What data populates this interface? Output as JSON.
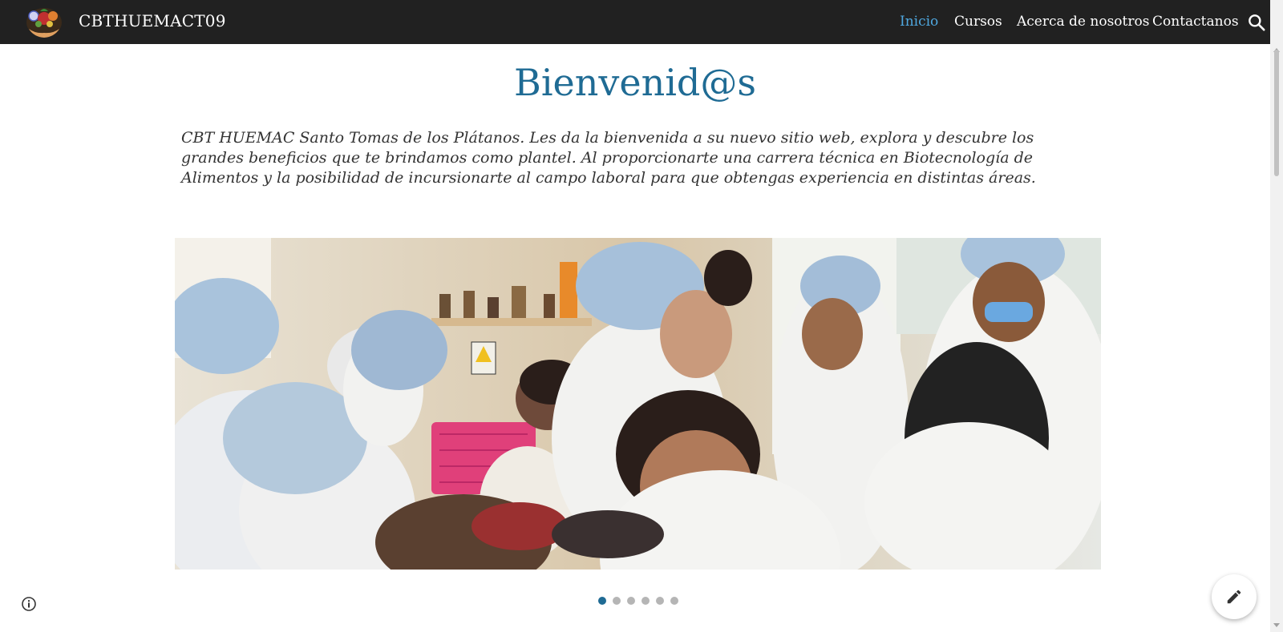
{
  "header": {
    "site_title": "CBTHUEMACT09",
    "logo_icon": "school-logo-icon",
    "nav": [
      {
        "label": "Inicio",
        "active": true
      },
      {
        "label": "Cursos",
        "active": false
      },
      {
        "label": "Acerca de nosotros",
        "active": false
      },
      {
        "label": "Contactanos",
        "active": false
      }
    ],
    "search_icon": "search-icon"
  },
  "main": {
    "heading": "Bienvenid@s",
    "intro": "CBT HUEMAC Santo Tomas de los Plátanos. Les da la bienvenida a su nuevo sitio web, explora y descubre los grandes beneficios que te brindamos como plantel. Al proporcionarte una carrera técnica en Biotecnología de Alimentos y la posibilidad de incursionarte al campo laboral para que obtengas experiencia en distintas áreas.",
    "carousel": {
      "slide_count": 6,
      "current_slide": 1
    }
  },
  "footer": {
    "info_icon": "info-icon",
    "edit_icon": "pencil-icon"
  },
  "colors": {
    "header_bg": "#212121",
    "active_nav": "#4fa8e0",
    "heading": "#1f6b94",
    "body_text": "#333333"
  }
}
